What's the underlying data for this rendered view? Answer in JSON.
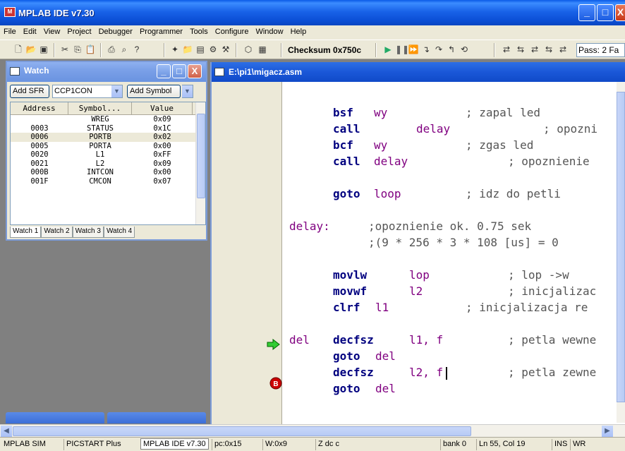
{
  "app": {
    "title": "MPLAB IDE v7.30"
  },
  "menu": [
    "File",
    "Edit",
    "View",
    "Project",
    "Debugger",
    "Programmer",
    "Tools",
    "Configure",
    "Window",
    "Help"
  ],
  "toolbar": {
    "checksum": "Checksum 0x750c",
    "pass": "Pass: 2 Fa"
  },
  "watch": {
    "title": "Watch",
    "add_sfr": "Add SFR",
    "sfr_combo": "CCP1CON",
    "add_symbol": "Add Symbol",
    "columns": [
      "Address",
      "Symbol...",
      "Value"
    ],
    "rows": [
      {
        "address": "",
        "symbol": "WREG",
        "value": "0x09"
      },
      {
        "address": "0003",
        "symbol": "STATUS",
        "value": "0x1C"
      },
      {
        "address": "0006",
        "symbol": "PORTB",
        "value": "0x02"
      },
      {
        "address": "0005",
        "symbol": "PORTA",
        "value": "0x00"
      },
      {
        "address": "0020",
        "symbol": "L1",
        "value": "0xFF"
      },
      {
        "address": "0021",
        "symbol": "L2",
        "value": "0x09"
      },
      {
        "address": "000B",
        "symbol": "INTCON",
        "value": "0x00"
      },
      {
        "address": "001F",
        "symbol": "CMCON",
        "value": "0x07"
      }
    ],
    "tabs": [
      "Watch 1",
      "Watch 2",
      "Watch 3",
      "Watch 4"
    ]
  },
  "editor": {
    "title": "E:\\pi1\\migacz.asm",
    "lines": [
      {
        "label": "",
        "instr": "bsf",
        "operand": "wy",
        "comment": "; zapal led"
      },
      {
        "label": "",
        "instr": "call",
        "operand": "delay",
        "comment": "; opozni"
      },
      {
        "label": "",
        "instr": "bcf",
        "operand": "wy",
        "comment": "; zgas led"
      },
      {
        "label": "",
        "instr": "call",
        "operand": "delay",
        "comment": "; opoznienie"
      },
      {
        "label": "",
        "instr": "goto",
        "operand": "loop",
        "comment": "; idz do petli"
      },
      {
        "label": "delay:",
        "instr": "",
        "operand": "",
        "comment": ";opoznienie ok. 0.75 sek"
      },
      {
        "label": "",
        "instr": "",
        "operand": "",
        "comment": ";(9 * 256 * 3 * 108 [us] = 0"
      },
      {
        "label": "",
        "instr": "movlw",
        "operand": "lop",
        "comment": "; lop ->w"
      },
      {
        "label": "",
        "instr": "movwf",
        "operand": "l2",
        "comment": "; inicjalizac"
      },
      {
        "label": "",
        "instr": "clrf",
        "operand": "l1",
        "comment": "; inicjalizacja re"
      },
      {
        "label": "del",
        "instr": "decfsz",
        "operand": "l1, f",
        "comment": "; petla wewne"
      },
      {
        "label": "",
        "instr": "goto",
        "operand": "del",
        "comment": ""
      },
      {
        "label": "",
        "instr": "decfsz",
        "operand": "l2, f",
        "comment": "; petla zewne"
      },
      {
        "label": "",
        "instr": "goto",
        "operand": "del",
        "comment": ""
      }
    ],
    "breakpoint_marker": "B"
  },
  "status": {
    "mode": "MPLAB SIM",
    "programmer": "PICSTART Plus",
    "app": "MPLAB IDE v7.30",
    "pc": "pc:0x15",
    "w": "W:0x9",
    "flags": "Z dc c",
    "bank": "bank 0",
    "pos": "Ln 55, Col 19",
    "ins": "INS",
    "wr": "WR"
  }
}
